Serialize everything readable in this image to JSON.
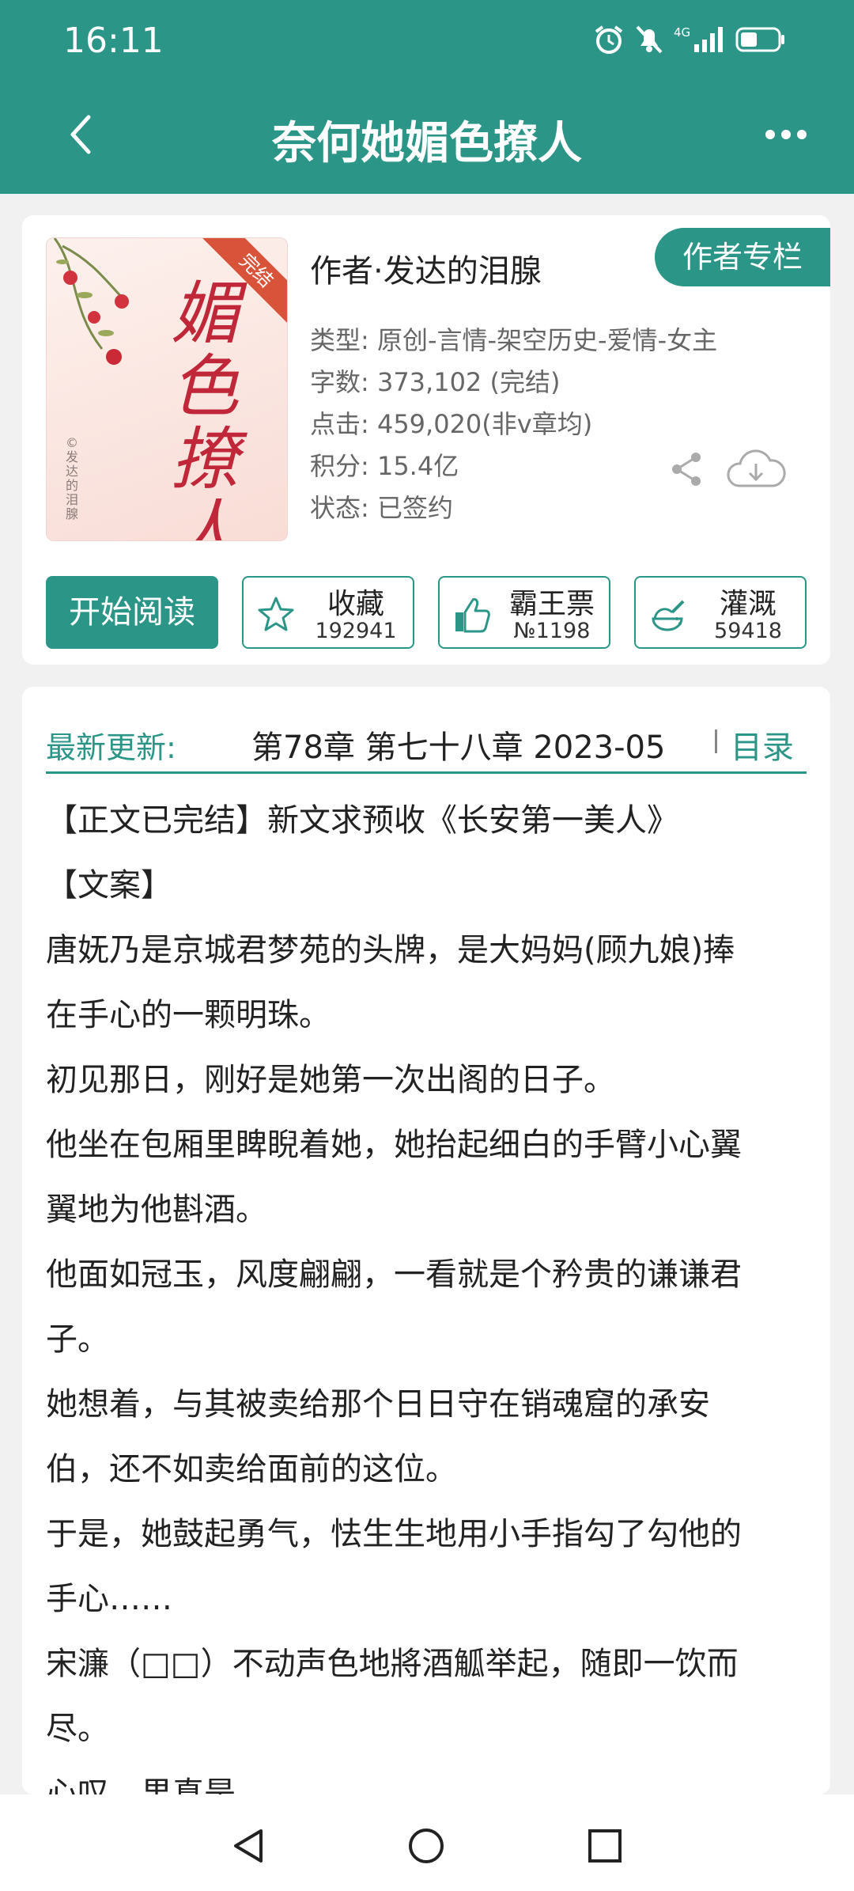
{
  "status_bar": {
    "time": "16:11",
    "icons": [
      "alarm-icon",
      "mute-icon",
      "signal-4g-icon",
      "battery-icon"
    ]
  },
  "nav": {
    "title": "奈何她媚色撩人",
    "back_icon": "chevron-left-icon",
    "more_icon": "more-dots-icon"
  },
  "book": {
    "cover": {
      "title": "媚色撩人",
      "ribbon": "完结",
      "author_mark": "©发达的泪腺"
    },
    "author_line": "作者·发达的泪腺",
    "author_column_button": "作者专栏",
    "meta": [
      "类型: 原创-言情-架空历史-爱情-女主",
      "字数: 373,102 (完结)",
      "点击: 459,020(非v章均)",
      "积分: 15.4亿",
      "状态: 已签约"
    ]
  },
  "actions": {
    "read": "开始阅读",
    "favorite": {
      "label": "收藏",
      "count": "192941",
      "icon": "star-icon"
    },
    "vote": {
      "label": "霸王票",
      "count": "№1198",
      "icon": "thumbs-up-icon"
    },
    "water": {
      "label": "灌溉",
      "count": "59418",
      "icon": "watering-icon"
    }
  },
  "latest": {
    "label": "最新更新:",
    "text": "第78章  第七十八章  2023-05",
    "toc": "目录"
  },
  "intro": [
    "【正文已完结】新文求预收《长安第一美人》",
    "【文案】",
    "唐妩乃是京城君梦苑的头牌，是大妈妈(顾九娘)捧",
    "在手心的一颗明珠。",
    "初见那日，刚好是她第一次出阁的日子。",
    "他坐在包厢里睥睨着她，她抬起细白的手臂小心翼",
    "翼地为他斟酒。",
    "他面如冠玉，风度翩翩，一看就是个矜贵的谦谦君",
    "子。",
    "她想着，与其被卖给那个日日守在销魂窟的承安",
    "伯，还不如卖给面前的这位。",
    "于是，她鼓起勇气，怯生生地用小手指勾了勾他的",
    "手心……",
    "宋濂（□□）不动声色地將酒觚举起，随即一饮而",
    "尽。",
    "心叹，果真是"
  ],
  "colors": {
    "accent": "#2b9688",
    "ribbon": "#d9533a"
  }
}
